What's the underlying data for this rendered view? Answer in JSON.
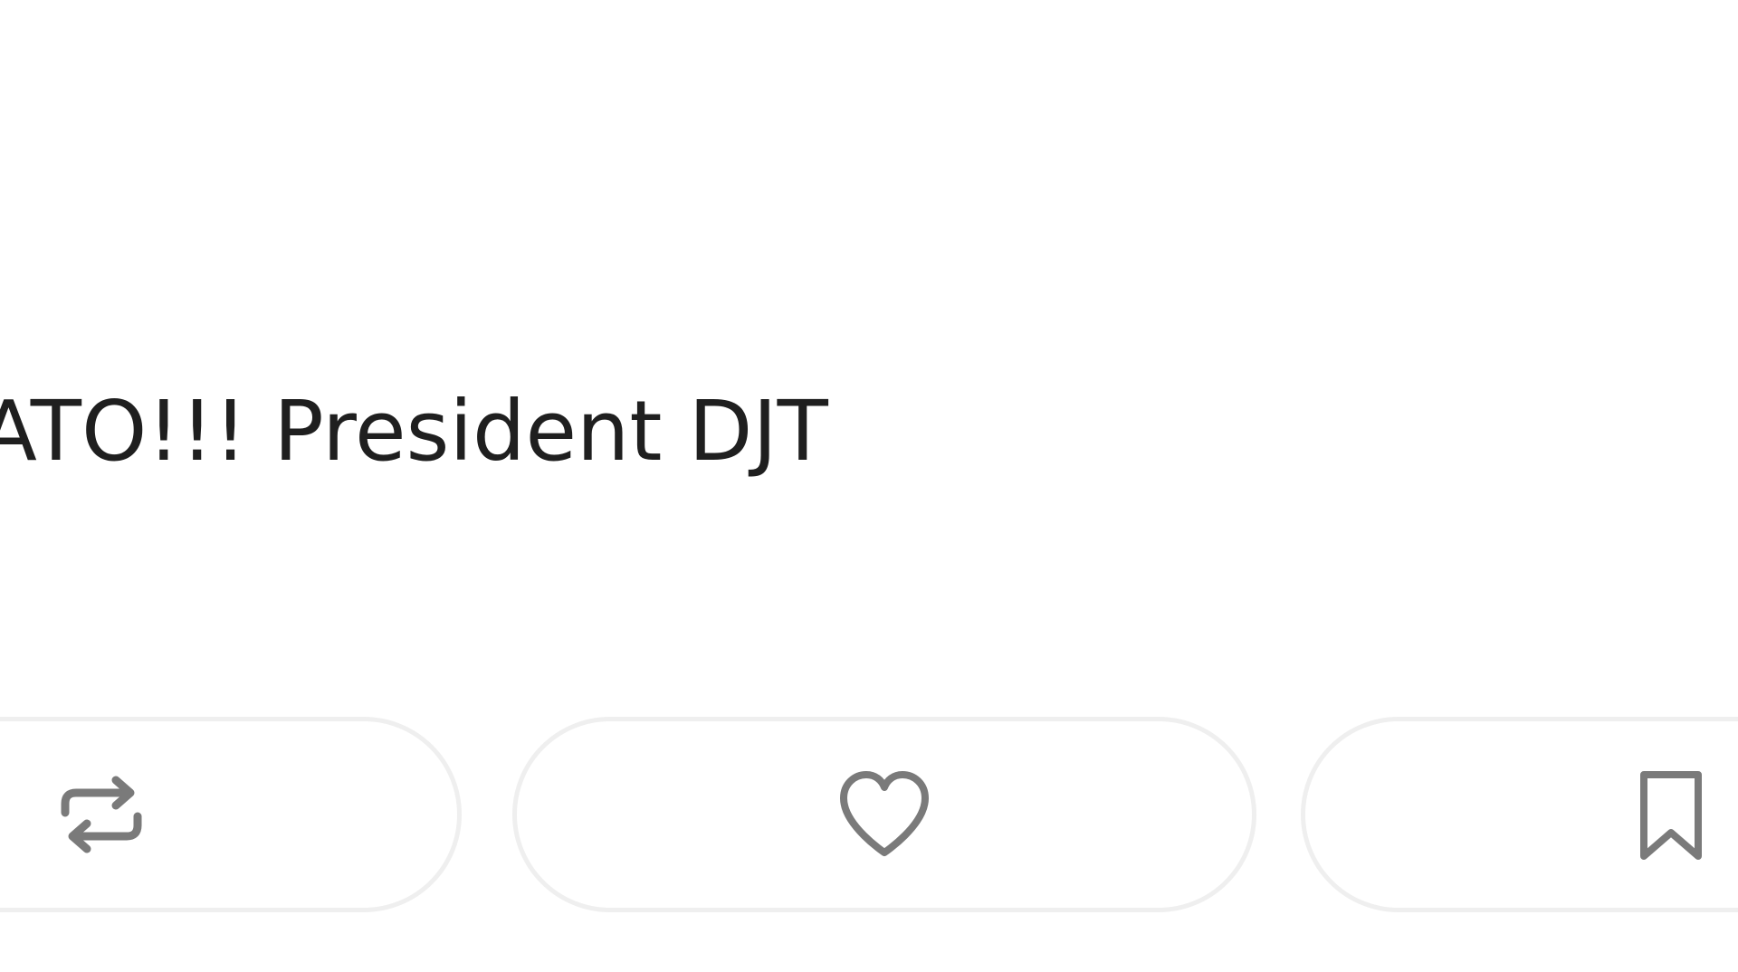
{
  "post": {
    "text": "ATO!!! President DJT"
  },
  "actions": {
    "repost": {
      "icon": "repost-icon"
    },
    "like": {
      "icon": "heart-icon"
    },
    "save": {
      "icon": "bookmark-icon"
    }
  },
  "colors": {
    "text": "#1f1f1f",
    "icon": "#7a7a7a",
    "pill_border": "#efefef",
    "background": "#ffffff"
  }
}
